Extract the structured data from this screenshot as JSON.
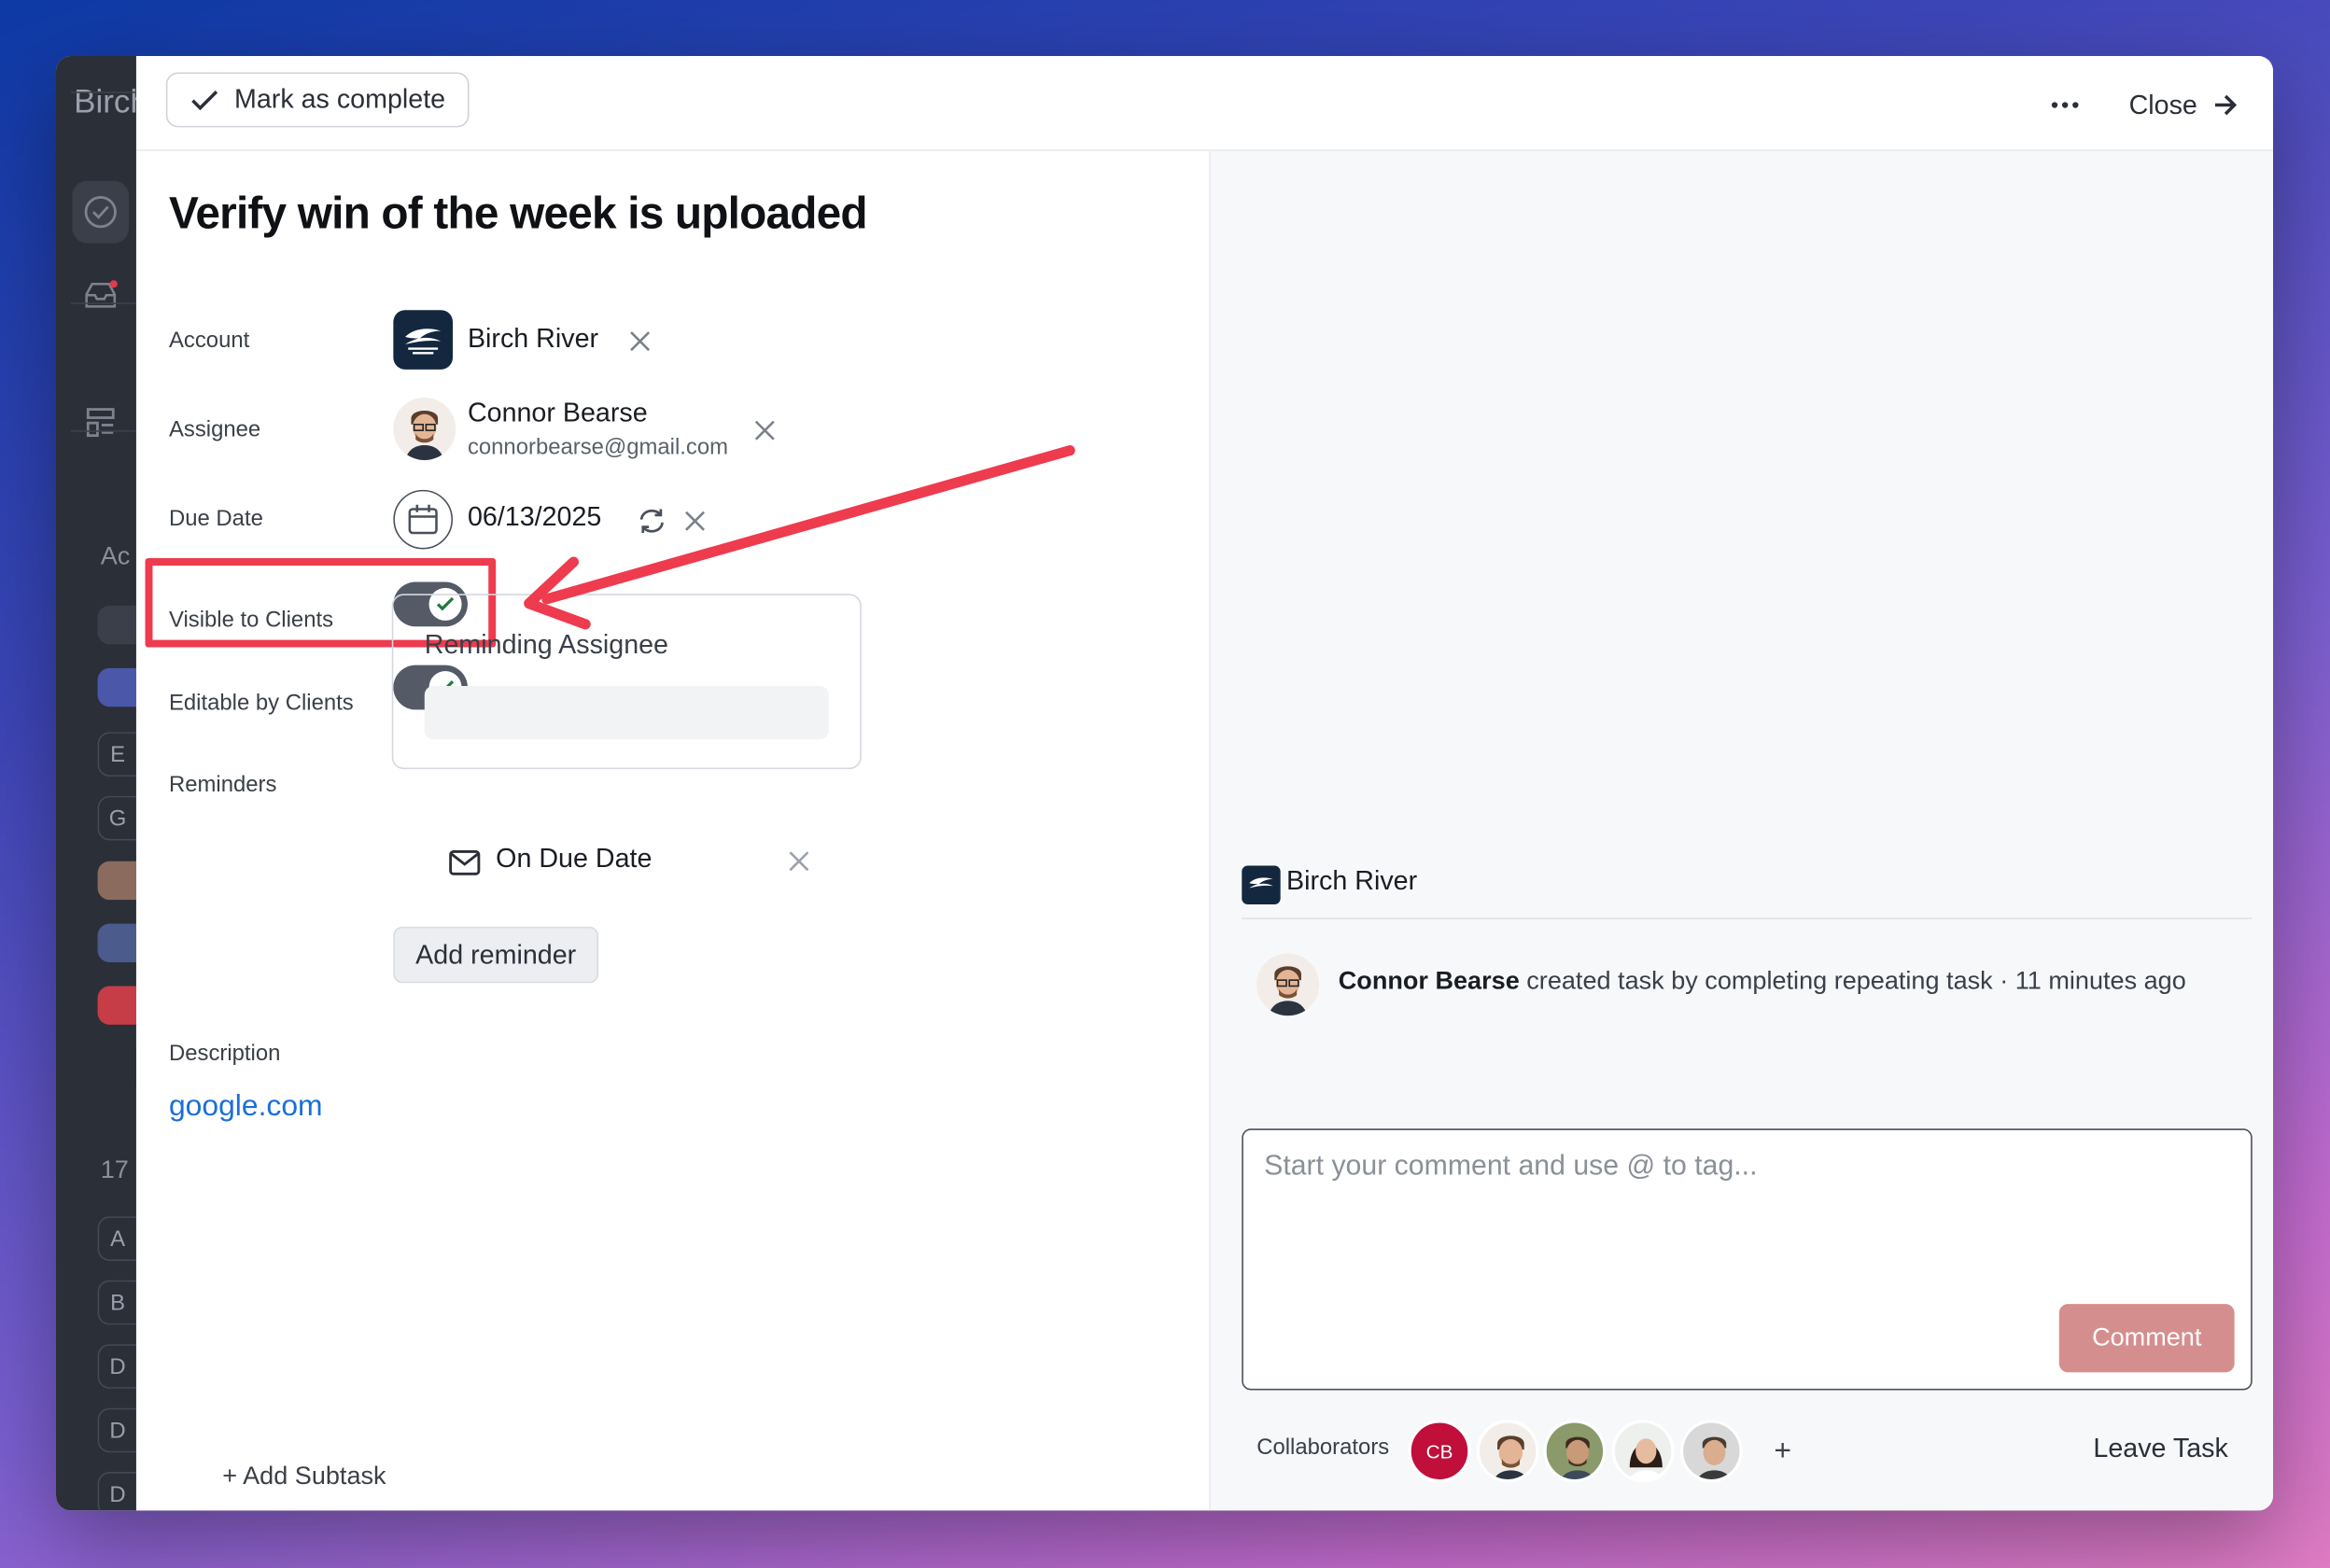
{
  "app": {
    "logo_text": "Birch"
  },
  "sidebar": {
    "section_label": "Ac",
    "count": "17",
    "letters": [
      "E",
      "G"
    ],
    "letters_bottom": [
      "A",
      "B",
      "D",
      "D",
      "D"
    ]
  },
  "toolbar": {
    "mark_complete_label": "Mark as complete",
    "close_label": "Close"
  },
  "task": {
    "title": "Verify win of the week is uploaded",
    "fields": {
      "account_label": "Account",
      "account_value": "Birch River",
      "assignee_label": "Assignee",
      "assignee_name": "Connor Bearse",
      "assignee_email": "connorbearse@gmail.com",
      "due_date_label": "Due Date",
      "due_date_value": "06/13/2025",
      "visible_label": "Visible to Clients",
      "visible_on": true,
      "editable_label": "Editable by Clients",
      "editable_on": true,
      "reminders_label": "Reminders",
      "reminder_card_title": "Reminding Assignee",
      "reminder_item": "On Due Date",
      "add_reminder_label": "Add reminder",
      "description_label": "Description",
      "description_link": "google.com"
    },
    "add_subtask_label": "+ Add Subtask"
  },
  "activity": {
    "account_name": "Birch River",
    "actor": "Connor Bearse",
    "action": " created task by completing repeating task · 11 minutes ago"
  },
  "comment": {
    "placeholder": "Start your comment and use @ to tag...",
    "button_label": "Comment"
  },
  "collaborators": {
    "label": "Collaborators",
    "initials": "CB",
    "add_symbol": "+",
    "leave_label": "Leave Task"
  },
  "colors": {
    "accent_toggle": "#545b66",
    "annotation_red": "#ee3b4e",
    "link_blue": "#1a6fd8",
    "comment_button": "#d58e8e",
    "collaborator_cb": "#c00f3b",
    "account_logo_bg": "#13283f"
  },
  "icons": {
    "check": "check-icon",
    "more": "more-horizontal-icon",
    "close_arrow": "arrow-right-icon",
    "clear": "close-icon",
    "calendar": "calendar-icon",
    "repeat": "repeat-icon",
    "mail": "mail-icon"
  }
}
